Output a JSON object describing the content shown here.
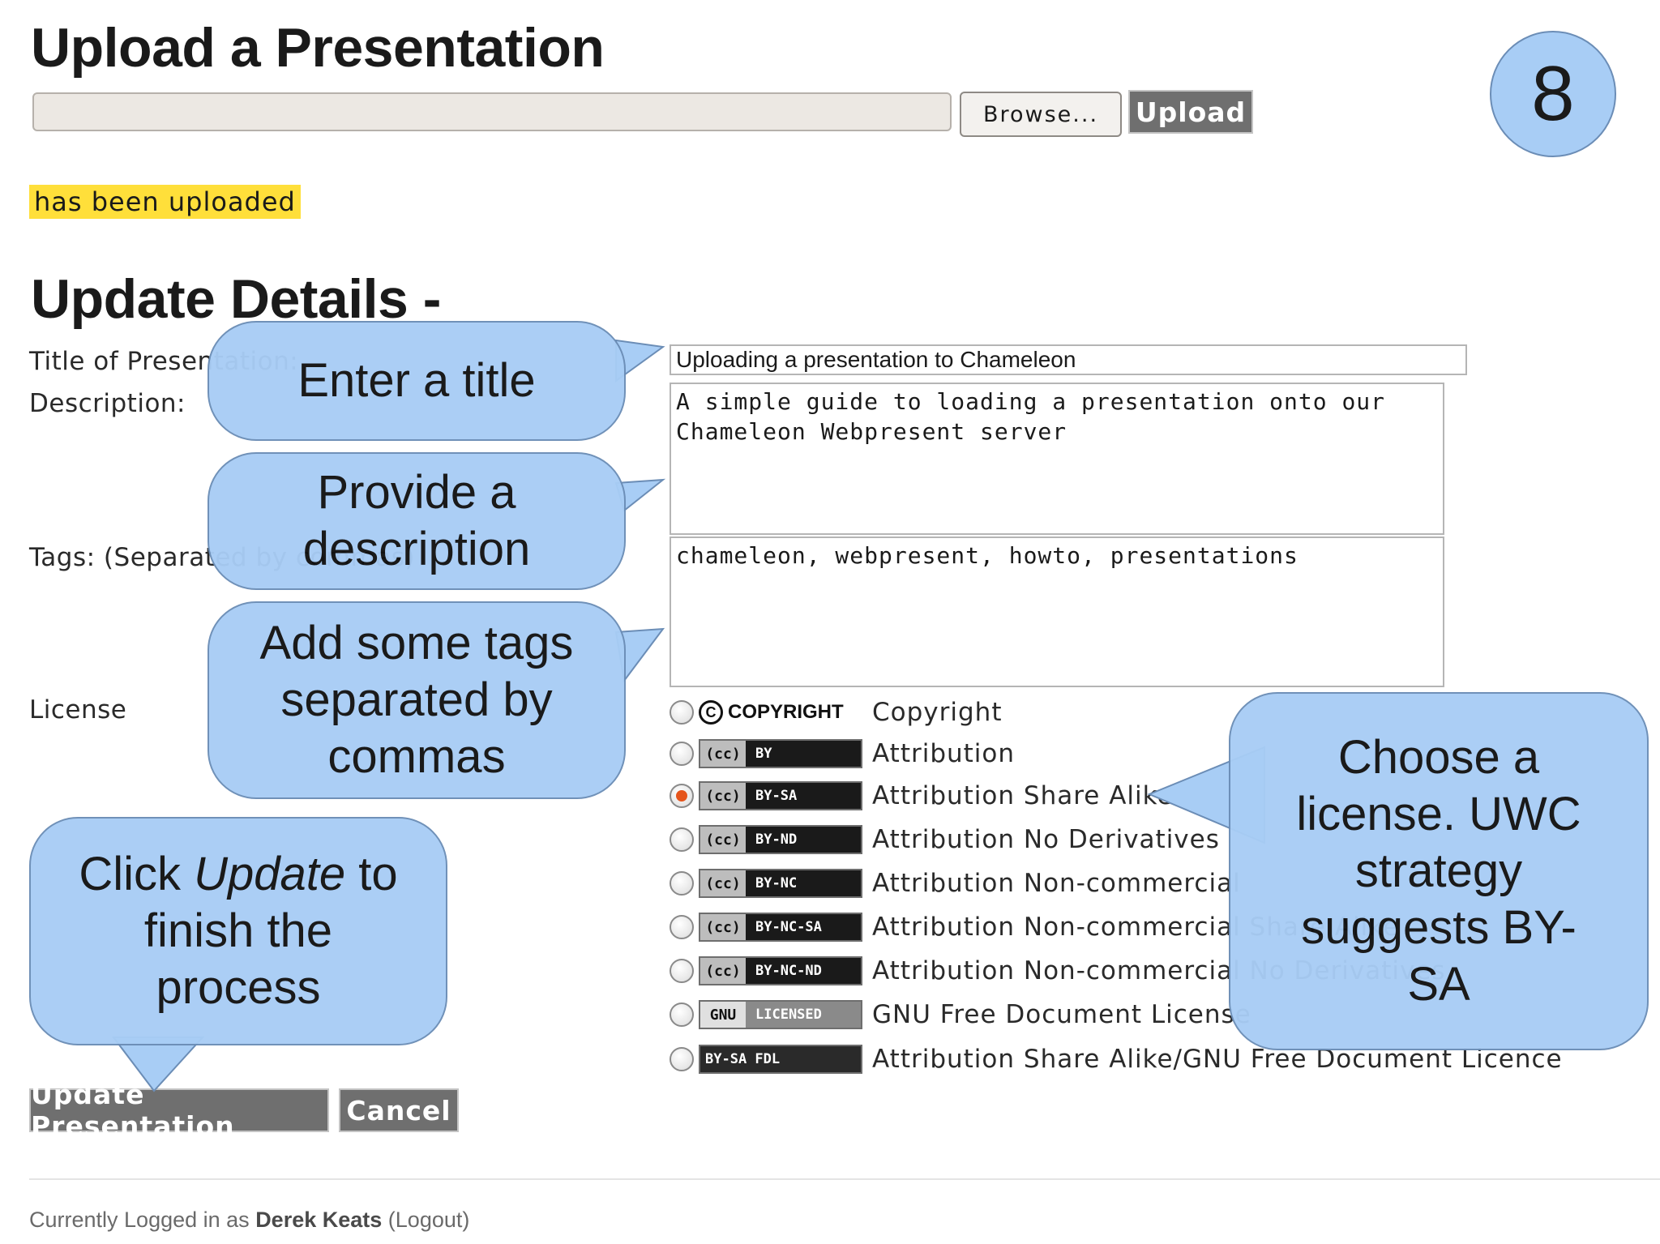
{
  "upload": {
    "title": "Upload a Presentation",
    "browse_label": "Browse...",
    "upload_label": "Upload",
    "status": "has been uploaded"
  },
  "slide_number": "8",
  "details": {
    "title": "Update Details -",
    "title_label": "Title of Presentation:",
    "title_value": "Uploading a presentation to Chameleon",
    "description_label": "Description:",
    "description_value": "A simple guide to loading a presentation onto our Chameleon Webpresent server",
    "tags_label": "Tags: (Separated by commas)",
    "tags_value": "chameleon, webpresent, howto, presentations",
    "license_label": "License"
  },
  "licenses": [
    {
      "badge": "COPYRIGHT",
      "label": "Copyright",
      "checked": false
    },
    {
      "badge": "BY",
      "label": "Attribution",
      "checked": false
    },
    {
      "badge": "BY-SA",
      "label": "Attribution Share Alike",
      "checked": true
    },
    {
      "badge": "BY-ND",
      "label": "Attribution No Derivatives",
      "checked": false
    },
    {
      "badge": "BY-NC",
      "label": "Attribution Non-commercial",
      "checked": false
    },
    {
      "badge": "BY-NC-SA",
      "label": "Attribution Non-commercial Share Alike",
      "checked": false
    },
    {
      "badge": "BY-NC-ND",
      "label": "Attribution Non-commercial No Derivatives",
      "checked": false
    },
    {
      "badge": "LICENSED",
      "label": "GNU Free Document License",
      "checked": false
    },
    {
      "badge": "BY-SA FDL",
      "label": "Attribution Share Alike/GNU Free Document Licence",
      "checked": false
    }
  ],
  "buttons": {
    "update_label": "Update Presentation",
    "cancel_label": "Cancel"
  },
  "footer": {
    "prefix": "Currently Logged in as",
    "user": "Derek Keats",
    "logout": "(Logout)"
  },
  "callouts": {
    "title_tip": "Enter a title",
    "description_tip": "Provide a description",
    "tags_tip": "Add some tags separated by commas",
    "update_tip_before": "Click",
    "update_tip_em": "Update",
    "update_tip_after": "to finish the process",
    "license_tip": "Choose a license. UWC strategy suggests BY-SA"
  },
  "colors": {
    "callout_fill": "#a8cdf5",
    "status_highlight": "#ffdf3a",
    "button_gray": "#6f6f6f",
    "radio_selected": "#e5541b"
  }
}
